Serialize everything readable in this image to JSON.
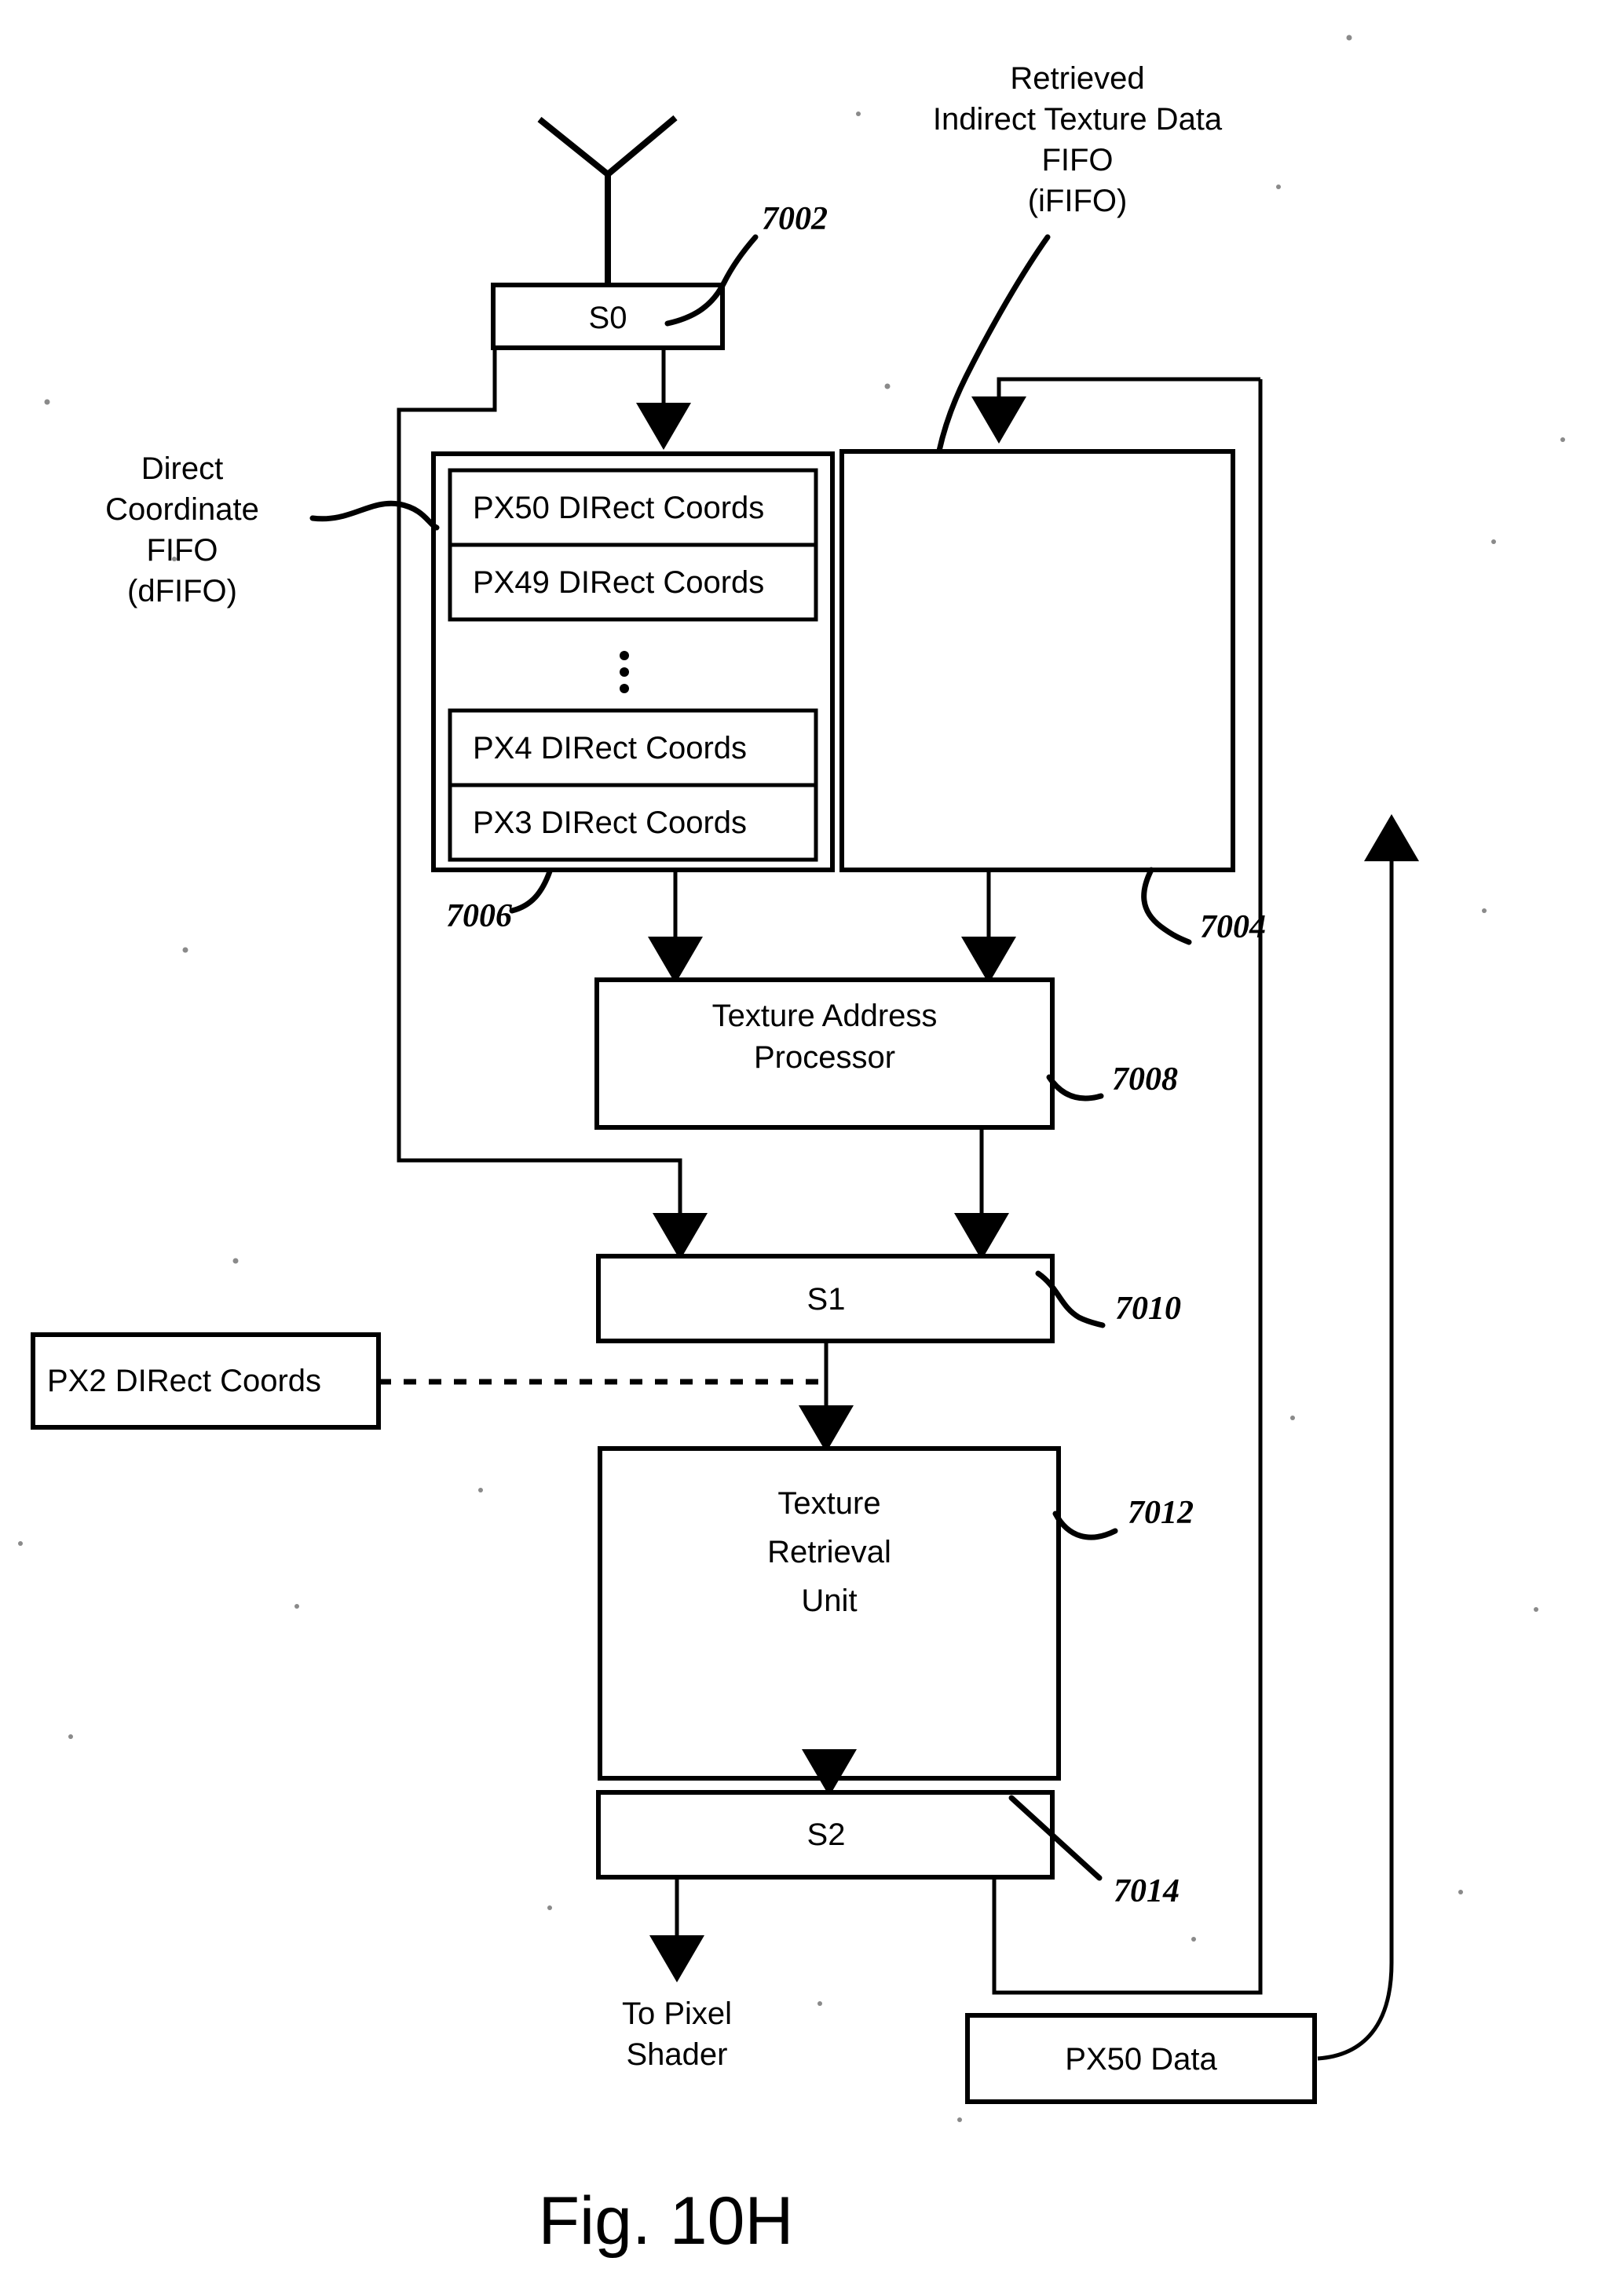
{
  "figure": {
    "caption": "Fig. 10H"
  },
  "labels": {
    "dfifo": {
      "line1": "Direct",
      "line2": "Coordinate",
      "line3": "FIFO",
      "line4": "(dFIFO)"
    },
    "ififo": {
      "line1": "Retrieved",
      "line2": "Indirect Texture Data",
      "line3": "FIFO",
      "line4": "(iFIFO)"
    },
    "output": {
      "line1": "To Pixel",
      "line2": "Shader"
    }
  },
  "blocks": {
    "s0": {
      "label": "S0",
      "ref": "7002"
    },
    "ififo_box": {
      "label": "",
      "ref": "7004"
    },
    "dfifo_box": {
      "label": "",
      "ref": "7006"
    },
    "texture_address_processor": {
      "line1": "Texture Address",
      "line2": "Processor",
      "ref": "7008"
    },
    "s1": {
      "label": "S1",
      "ref": "7010"
    },
    "texture_retrieval_unit": {
      "line1": "Texture",
      "line2": "Retrieval",
      "line3": "Unit",
      "ref": "7012"
    },
    "s2": {
      "label": "S2",
      "ref": "7014"
    },
    "px2_direct_coords": {
      "label": "PX2 DIRect Coords"
    },
    "px50_data": {
      "label": "PX50 Data"
    }
  },
  "dfifo_entries": [
    {
      "label": "PX50 DIRect Coords"
    },
    {
      "label": "PX49 DIRect Coords"
    },
    {
      "label": "PX4 DIRect Coords"
    },
    {
      "label": "PX3 DIRect Coords"
    }
  ],
  "colors": {
    "ink": "#000000",
    "paper": "#ffffff"
  }
}
